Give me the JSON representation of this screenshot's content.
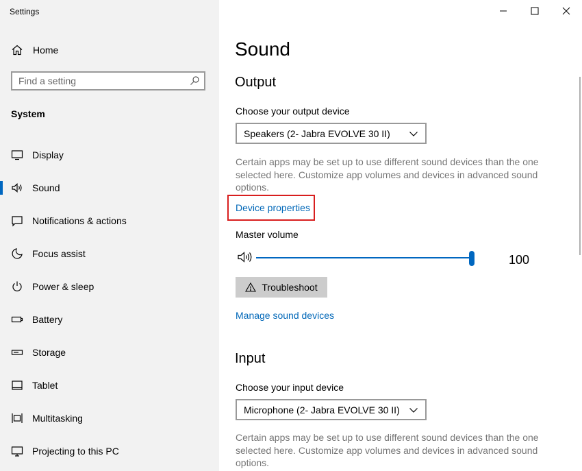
{
  "window": {
    "app_title": "Settings",
    "controls": [
      "minimize",
      "maximize",
      "close"
    ]
  },
  "sidebar": {
    "home_label": "Home",
    "search_placeholder": "Find a setting",
    "section_title": "System",
    "items": [
      {
        "label": "Display",
        "icon": "display-icon",
        "active": false
      },
      {
        "label": "Sound",
        "icon": "sound-icon",
        "active": true
      },
      {
        "label": "Notifications & actions",
        "icon": "notifications-icon",
        "active": false
      },
      {
        "label": "Focus assist",
        "icon": "moon-icon",
        "active": false
      },
      {
        "label": "Power & sleep",
        "icon": "power-icon",
        "active": false
      },
      {
        "label": "Battery",
        "icon": "battery-icon",
        "active": false
      },
      {
        "label": "Storage",
        "icon": "storage-icon",
        "active": false
      },
      {
        "label": "Tablet",
        "icon": "tablet-icon",
        "active": false
      },
      {
        "label": "Multitasking",
        "icon": "multitasking-icon",
        "active": false
      },
      {
        "label": "Projecting to this PC",
        "icon": "projecting-icon",
        "active": false
      }
    ]
  },
  "main": {
    "page_title": "Sound",
    "output": {
      "heading": "Output",
      "choose_label": "Choose your output device",
      "selected_device": "Speakers (2- Jabra EVOLVE 30 II)",
      "help_text": "Certain apps may be set up to use different sound devices than the one selected here. Customize app volumes and devices in advanced sound options.",
      "device_properties_link": "Device properties",
      "master_volume_label": "Master volume",
      "volume_value": "100",
      "volume_level": 100,
      "troubleshoot_label": "Troubleshoot",
      "manage_link": "Manage sound devices"
    },
    "input": {
      "heading": "Input",
      "choose_label": "Choose your input device",
      "selected_device": "Microphone (2- Jabra EVOLVE 30 II)",
      "help_text": "Certain apps may be set up to use different sound devices than the one selected here. Customize app volumes and devices in advanced sound options."
    }
  },
  "colors": {
    "accent": "#0067c0",
    "link": "#0067b8",
    "highlight": "#d81e1e",
    "sidebar_bg": "#f2f2f2"
  }
}
